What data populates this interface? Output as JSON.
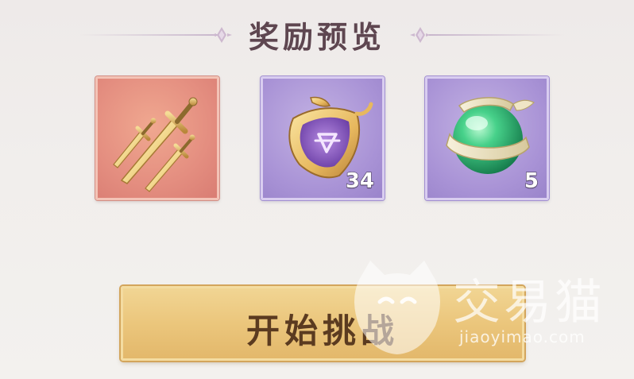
{
  "header": {
    "title": "奖励预览"
  },
  "rewards": [
    {
      "icon": "triple-dagger-icon",
      "count": "",
      "rarity_color": "#e48e80"
    },
    {
      "icon": "purple-badge-token-icon",
      "count": "34",
      "rarity_color": "#a993d6"
    },
    {
      "icon": "green-orb-icon",
      "count": "5",
      "rarity_color": "#a993d6"
    }
  ],
  "start_button": {
    "label": "开始挑战"
  },
  "watermark": {
    "brand": "交易猫",
    "url": "jiaoyimao.com"
  }
}
